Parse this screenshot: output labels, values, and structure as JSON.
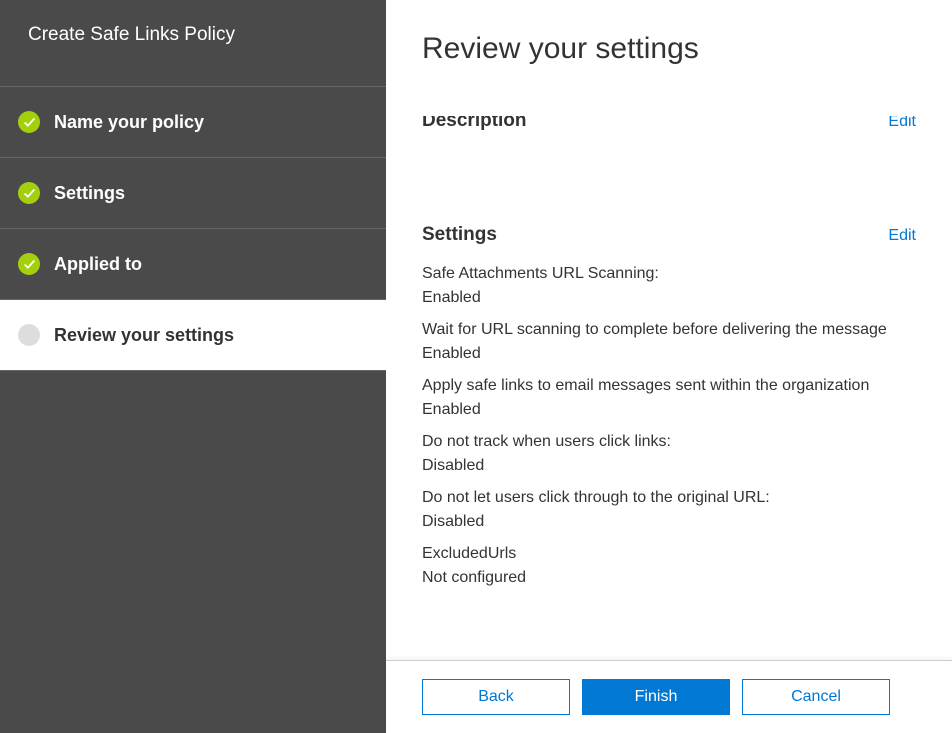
{
  "sidebar": {
    "title": "Create Safe Links Policy",
    "steps": [
      {
        "label": "Name your policy",
        "status": "done"
      },
      {
        "label": "Settings",
        "status": "done"
      },
      {
        "label": "Applied to",
        "status": "done"
      },
      {
        "label": "Review your settings",
        "status": "current"
      }
    ]
  },
  "main": {
    "title": "Review your settings",
    "sections": {
      "description": {
        "title": "Description",
        "edit": "Edit"
      },
      "settings": {
        "title": "Settings",
        "edit": "Edit",
        "items": [
          {
            "label": "Safe Attachments URL Scanning:",
            "value": "Enabled"
          },
          {
            "label": "Wait for URL scanning to complete before delivering the message",
            "value": "Enabled"
          },
          {
            "label": "Apply safe links to email messages sent within the organization",
            "value": "Enabled"
          },
          {
            "label": "Do not track when users click links:",
            "value": "Disabled"
          },
          {
            "label": "Do not let users click through to the original URL:",
            "value": "Disabled"
          },
          {
            "label": "ExcludedUrls",
            "value": "Not configured"
          }
        ]
      }
    }
  },
  "footer": {
    "back": "Back",
    "finish": "Finish",
    "cancel": "Cancel"
  }
}
